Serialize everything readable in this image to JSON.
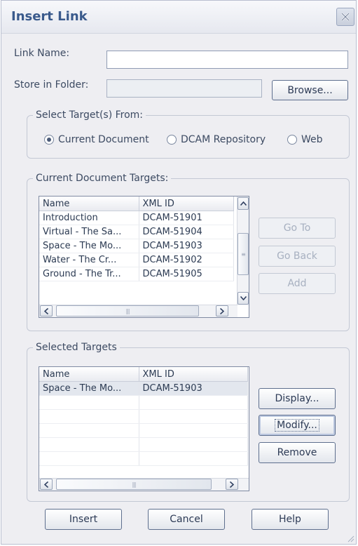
{
  "window": {
    "title": "Insert Link"
  },
  "form": {
    "link_name_label": "Link Name:",
    "link_name_value": "",
    "store_folder_label": "Store in Folder:",
    "store_folder_value": "",
    "browse_label": "Browse..."
  },
  "target_source": {
    "legend": "Select Target(s) From:",
    "options": [
      {
        "label": "Current Document",
        "selected": true
      },
      {
        "label": "DCAM Repository",
        "selected": false
      },
      {
        "label": "Web",
        "selected": false
      }
    ]
  },
  "current_targets": {
    "legend": "Current Document Targets:",
    "columns": [
      "Name",
      "XML ID"
    ],
    "rows": [
      [
        "Introduction",
        "DCAM-51901"
      ],
      [
        "Virtual - The Sa...",
        "DCAM-51904"
      ],
      [
        "Space - The Mo...",
        "DCAM-51903"
      ],
      [
        "Water - The Cr...",
        "DCAM-51902"
      ],
      [
        "Ground - The Tr...",
        "DCAM-51905"
      ]
    ],
    "buttons": [
      "Go To",
      "Go Back",
      "Add"
    ]
  },
  "selected_targets": {
    "legend": "Selected Targets",
    "columns": [
      "Name",
      "XML ID"
    ],
    "rows": [
      [
        "Space - The Mo...",
        "DCAM-51903"
      ]
    ],
    "buttons": [
      "Display...",
      "Modify...",
      "Remove"
    ]
  },
  "footer": {
    "insert": "Insert",
    "cancel": "Cancel",
    "help": "Help"
  },
  "icons": {
    "close": "close-icon",
    "scroll_up": "arrow-up-icon",
    "scroll_down": "arrow-down-icon",
    "scroll_left": "arrow-left-icon",
    "scroll_right": "arrow-right-icon"
  },
  "colors": {
    "title": "#3a5a8c",
    "window_bg": "#eeeef2"
  }
}
